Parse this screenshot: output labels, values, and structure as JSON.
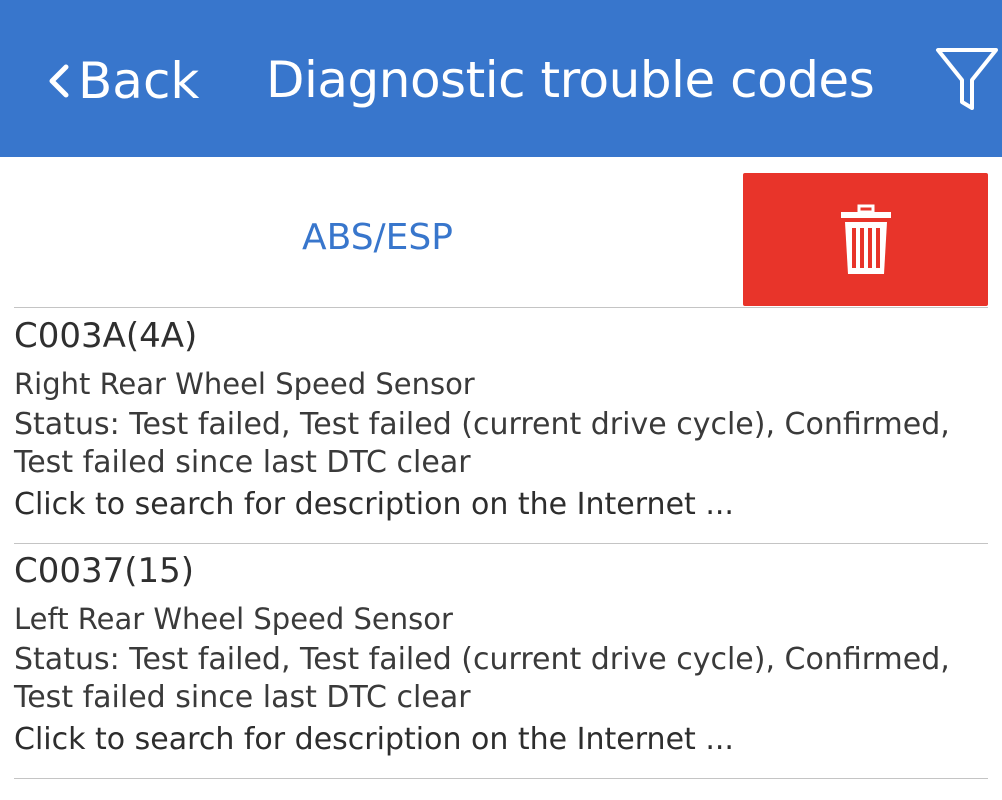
{
  "header": {
    "back_label": "Back",
    "title": "Diagnostic trouble codes",
    "background": "#3876cc",
    "back_icon": "chevron-left-icon",
    "filter_icon": "filter-icon"
  },
  "toolbar": {
    "module": "ABS/ESP",
    "delete_icon": "trash-icon",
    "delete_color": "#e8342a"
  },
  "dtcs": [
    {
      "code": "C003A(4A)",
      "description": "Right Rear Wheel Speed Sensor",
      "status": "Status: Test failed, Test failed (current drive cycle), Confirmed, Test failed since last DTC clear",
      "link": "Click to search for description on the Internet ..."
    },
    {
      "code": "C0037(15)",
      "description": "Left Rear Wheel Speed Sensor",
      "status": "Status: Test failed, Test failed (current drive cycle), Confirmed, Test failed since last DTC clear",
      "link": "Click to search for description on the Internet ..."
    }
  ]
}
